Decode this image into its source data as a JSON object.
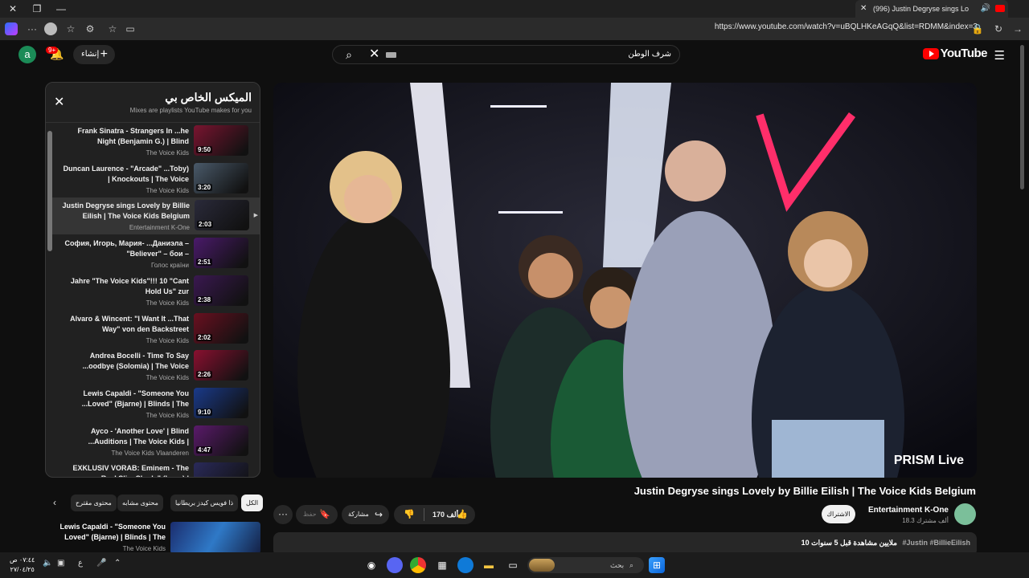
{
  "browser": {
    "tab_title": "(996) Justin Degryse sings Lo",
    "url": "https://www.youtube.com/watch?v=uBQLHKeAGqQ&list=RDMM&index=3"
  },
  "masthead": {
    "avatar_letter": "a",
    "notification_count": "9+",
    "create_label": "إنشاء",
    "search_value": "شرف الوطن",
    "logo_text": "YouTube"
  },
  "playlist": {
    "title": "الميكس الخاص بي",
    "subtitle": "Mixes are playlists YouTube makes for you",
    "items": [
      {
        "title": "Frank Sinatra - Strangers In ...he Night (Benjamin G.) | Blind",
        "channel": "The Voice Kids",
        "duration": "9:50",
        "thumb_color": "#7a1430",
        "active": false
      },
      {
        "title": "Duncan Laurence - \"Arcade\" ...Toby) | Knockouts | The Voice",
        "channel": "The Voice Kids",
        "duration": "3:20",
        "thumb_color": "#4a5a6a",
        "active": false
      },
      {
        "title": "Justin Degryse sings Lovely by Billie Eilish | The Voice Kids Belgium",
        "channel": "Entertainment K-One",
        "duration": "2:03",
        "thumb_color": "#2a2a3a",
        "active": true
      },
      {
        "title": "София, Игорь, Мария- ...Даниэла – \"Believer\" – бои –",
        "channel": "Голос країни",
        "duration": "2:51",
        "thumb_color": "#4a1a6a",
        "active": false
      },
      {
        "title": "Jahre \"The Voice Kids\"!!! 10 \"Cant Hold Us\" zur",
        "channel": "The Voice Kids",
        "duration": "2:38",
        "thumb_color": "#3a1850",
        "active": false
      },
      {
        "title": "Alvaro & Wincent: \"I Want It ...That Way\" von den Backstreet",
        "channel": "The Voice Kids",
        "duration": "2:02",
        "thumb_color": "#6a1020",
        "active": false
      },
      {
        "title": "Andrea Bocelli - Time To Say ...oodbye (Solomia) | The Voice",
        "channel": "The Voice Kids",
        "duration": "2:26",
        "thumb_color": "#8a1030",
        "active": false
      },
      {
        "title": "Lewis Capaldi - \"Someone You ...Loved\" (Bjarne) | Blinds | The",
        "channel": "The Voice Kids",
        "duration": "9:10",
        "thumb_color": "#1a3a8a",
        "active": false
      },
      {
        "title": "Ayco - 'Another Love' | Blind ...Auditions | The Voice Kids |",
        "channel": "The Voice Kids Vlaanderen",
        "duration": "4:47",
        "thumb_color": "#5a1a6a",
        "active": false
      },
      {
        "title": "EXKLUSIV VORAB: Eminem - The Real Slim Shady\" (Leon) |",
        "channel": "",
        "duration": "",
        "thumb_color": "#2a2a5a",
        "active": false
      }
    ]
  },
  "video": {
    "overlay_text": "PRISM Live",
    "title": "Justin Degryse sings Lovely by Billie Eilish | The Voice Kids Belgium",
    "channel": "Entertainment K-One",
    "subscribers": "18.3 ألف مشترك",
    "subscribe_label": "الاشتراك",
    "likes": "170 ألف",
    "share_label": "مشاركة",
    "save_label": "حفظ",
    "views": "10 ملايين مشاهدة",
    "age": "قبل 5 سنوات",
    "tags": "#Justin #BillieEilish"
  },
  "chips": [
    "الكل",
    "ذا فويس كيدز بريطانيا",
    "محتوى مشابه",
    "محتوى مقترح"
  ],
  "recommended": {
    "title": "Lewis Capaldi - \"Someone You Loved\" (Bjarne) | Blinds | The",
    "channel": "The Voice Kids"
  },
  "taskbar": {
    "search_placeholder": "بحث",
    "time": "٠٧:٤٤ ص",
    "date": "٢٧/٠٤/٢٥",
    "lang": "ع"
  }
}
